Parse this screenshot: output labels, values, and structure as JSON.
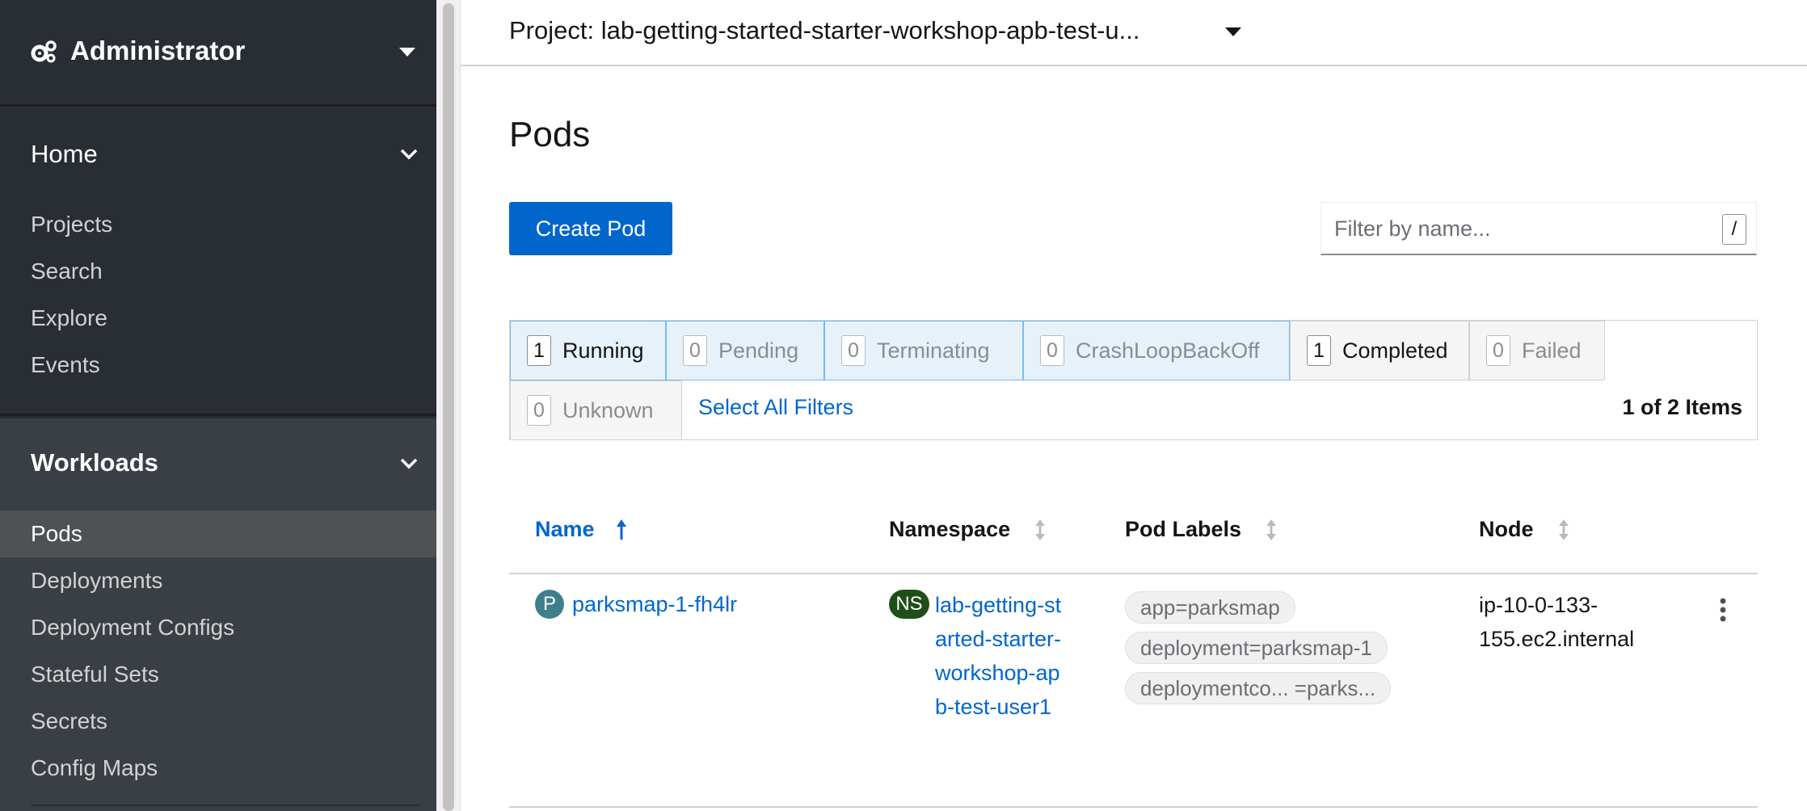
{
  "perspective": {
    "label": "Administrator"
  },
  "nav": {
    "home": {
      "title": "Home",
      "items": [
        "Projects",
        "Search",
        "Explore",
        "Events"
      ]
    },
    "workloads": {
      "title": "Workloads",
      "items": [
        "Pods",
        "Deployments",
        "Deployment Configs",
        "Stateful Sets",
        "Secrets",
        "Config Maps"
      ],
      "active": "Pods"
    }
  },
  "project": {
    "text": "Project: lab-getting-started-starter-workshop-apb-test-u..."
  },
  "page": {
    "title": "Pods",
    "create_label": "Create Pod"
  },
  "filter": {
    "placeholder": "Filter by name...",
    "shortcut": "/"
  },
  "status_filters": [
    {
      "count": "1",
      "label": "Running",
      "selected": true
    },
    {
      "count": "0",
      "label": "Pending",
      "selected": true
    },
    {
      "count": "0",
      "label": "Terminating",
      "selected": true
    },
    {
      "count": "0",
      "label": "CrashLoopBackOff",
      "selected": true
    },
    {
      "count": "1",
      "label": "Completed",
      "selected": false
    },
    {
      "count": "0",
      "label": "Failed",
      "selected": false
    },
    {
      "count": "0",
      "label": "Unknown",
      "selected": false
    }
  ],
  "select_all": "Select All Filters",
  "items_count": "1 of 2 Items",
  "table": {
    "columns": [
      "Name",
      "Namespace",
      "Pod Labels",
      "Node"
    ],
    "rows": [
      {
        "badge": "P",
        "name": "parksmap-1-fh4lr",
        "ns_badge": "NS",
        "namespace": "lab-getting-started-starter-workshop-apb-test-user1",
        "labels": [
          "app=parksmap",
          "deployment=parksmap-1",
          "deploymentco... =parks..."
        ],
        "node": "ip-10-0-133-155.ec2.internal"
      }
    ]
  },
  "colors": {
    "accent": "#0066cc",
    "sidebar": "#292e34",
    "selected_filter": "#e7f1fa"
  }
}
